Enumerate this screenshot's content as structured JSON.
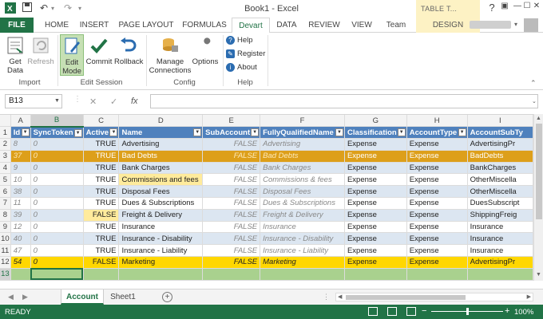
{
  "window": {
    "title": "Book1 - Excel",
    "context_group": "TABLE T...",
    "user_name_blurred": "",
    "controls": [
      "?",
      "▣",
      "—",
      "☐",
      "✕"
    ]
  },
  "tabs": [
    "FILE",
    "HOME",
    "INSERT",
    "PAGE LAYOUT",
    "FORMULAS",
    "Devart",
    "DATA",
    "REVIEW",
    "VIEW",
    "Team",
    "DESIGN"
  ],
  "ribbon": {
    "import": {
      "label": "Import",
      "get_data": "Get Data",
      "refresh": "Refresh"
    },
    "edit_session": {
      "label": "Edit Session",
      "edit_mode": "Edit Mode",
      "commit": "Commit",
      "rollback": "Rollback"
    },
    "config": {
      "label": "Config",
      "manage_connections": "Manage Connections",
      "options": "Options"
    },
    "help": {
      "label": "Help",
      "help": "Help",
      "register": "Register",
      "about": "About"
    }
  },
  "formula_bar": {
    "name_box": "B13",
    "fx": "fx",
    "cancel": "✕",
    "enter": "✓",
    "value": ""
  },
  "columns": [
    "A",
    "B",
    "C",
    "D",
    "E",
    "F",
    "G",
    "H",
    "I"
  ],
  "headers": [
    "Id",
    "SyncToken",
    "Active",
    "Name",
    "SubAccount",
    "FullyQualifiedName",
    "Classification",
    "AccountType",
    "AccountSubTy"
  ],
  "rows": [
    {
      "n": "2",
      "id": "8",
      "sync": "0",
      "active": "TRUE",
      "name": "Advertising",
      "sub": "FALSE",
      "fqn": "Advertising",
      "cls": "Expense",
      "type": "Expense",
      "subtype": "AdvertisingPr"
    },
    {
      "n": "3",
      "id": "37",
      "sync": "0",
      "active": "TRUE",
      "name": "Bad Debts",
      "sub": "FALSE",
      "fqn": "Bad Debts",
      "cls": "Expense",
      "type": "Expense",
      "subtype": "BadDebts"
    },
    {
      "n": "4",
      "id": "9",
      "sync": "0",
      "active": "TRUE",
      "name": "Bank Charges",
      "sub": "FALSE",
      "fqn": "Bank Charges",
      "cls": "Expense",
      "type": "Expense",
      "subtype": "BankCharges"
    },
    {
      "n": "5",
      "id": "10",
      "sync": "0",
      "active": "TRUE",
      "name": "Commissions and fees",
      "sub": "FALSE",
      "fqn": "Commissions & fees",
      "cls": "Expense",
      "type": "Expense",
      "subtype": "OtherMiscella"
    },
    {
      "n": "6",
      "id": "38",
      "sync": "0",
      "active": "TRUE",
      "name": "Disposal Fees",
      "sub": "FALSE",
      "fqn": "Disposal Fees",
      "cls": "Expense",
      "type": "Expense",
      "subtype": "OtherMiscella"
    },
    {
      "n": "7",
      "id": "11",
      "sync": "0",
      "active": "TRUE",
      "name": "Dues & Subscriptions",
      "sub": "FALSE",
      "fqn": "Dues & Subscriptions",
      "cls": "Expense",
      "type": "Expense",
      "subtype": "DuesSubscript"
    },
    {
      "n": "8",
      "id": "39",
      "sync": "0",
      "active": "FALSE",
      "name": "Freight & Delivery",
      "sub": "FALSE",
      "fqn": "Freight & Delivery",
      "cls": "Expense",
      "type": "Expense",
      "subtype": "ShippingFreig"
    },
    {
      "n": "9",
      "id": "12",
      "sync": "0",
      "active": "TRUE",
      "name": "Insurance",
      "sub": "FALSE",
      "fqn": "Insurance",
      "cls": "Expense",
      "type": "Expense",
      "subtype": "Insurance"
    },
    {
      "n": "10",
      "id": "40",
      "sync": "0",
      "active": "TRUE",
      "name": "Insurance - Disability",
      "sub": "FALSE",
      "fqn": "Insurance - Disability",
      "cls": "Expense",
      "type": "Expense",
      "subtype": "Insurance"
    },
    {
      "n": "11",
      "id": "47",
      "sync": "0",
      "active": "TRUE",
      "name": "Insurance - Liability",
      "sub": "FALSE",
      "fqn": "Insurance - Liability",
      "cls": "Expense",
      "type": "Expense",
      "subtype": "Insurance"
    },
    {
      "n": "12",
      "id": "54",
      "sync": "0",
      "active": "FALSE",
      "name": "Marketing",
      "sub": "FALSE",
      "fqn": "Marketing",
      "cls": "Expense",
      "type": "Expense",
      "subtype": "AdvertisingPr"
    }
  ],
  "new_row_number": "13",
  "sheets": [
    "Account",
    "Sheet1"
  ],
  "status": {
    "ready": "READY",
    "zoom": "100%"
  },
  "colors": {
    "accent": "#217346",
    "table_header": "#4f81bd",
    "band": "#dce6f1",
    "modified": "#dd9f1a",
    "deleted": "#ffd700",
    "new_row": "#a9d18e",
    "highlight": "#ffeb9c"
  }
}
